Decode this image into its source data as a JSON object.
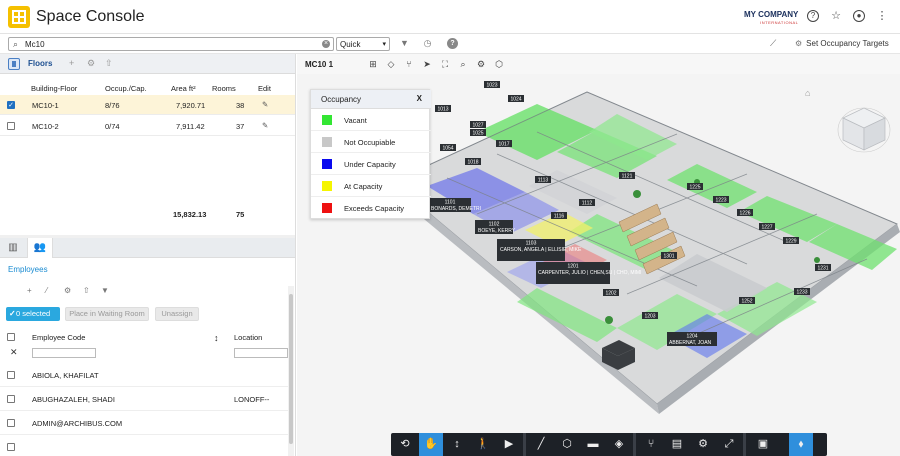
{
  "app": {
    "title": "Space Console",
    "company": "MY COMPANY",
    "company_sub": "INTERNATIONAL"
  },
  "topbar": {
    "icons": [
      "help-icon",
      "star-settings-icon",
      "user-icon",
      "more-icon"
    ]
  },
  "search": {
    "value": "Mc10",
    "mode": "Quick",
    "occupancy_targets_label": "Set Occupancy Targets"
  },
  "floors": {
    "title": "Floors",
    "columns": [
      "Building-Floor",
      "Occup./Cap.",
      "Area ft²",
      "Rooms",
      "Edit"
    ],
    "rows": [
      {
        "floor": "MC10-1",
        "occ": "8/76",
        "area": "7,920.71",
        "rooms": "38",
        "selected": true
      },
      {
        "floor": "MC10-2",
        "occ": "0/74",
        "area": "7,911.42",
        "rooms": "37",
        "selected": false
      }
    ],
    "total_area": "15,832.13",
    "total_rooms": "75"
  },
  "employees": {
    "title": "Employees",
    "selected_btn": "0 selected",
    "waiting_btn": "Place in Waiting Room",
    "unassign_btn": "Unassign",
    "col_code": "Employee Code",
    "col_location": "Location",
    "rows": [
      {
        "code": "ABIOLA, KHAFILAT",
        "location": ""
      },
      {
        "code": "ABUGHAZALEH, SHADI",
        "location": "LONOFF--"
      },
      {
        "code": "ADMIN@ARCHIBUS.COM",
        "location": ""
      }
    ]
  },
  "viewer": {
    "floor_label": "MC10 1",
    "legend_title": "Occupancy",
    "legend_close": "X",
    "legend": [
      {
        "label": "Vacant",
        "color": "#33e633"
      },
      {
        "label": "Not Occupiable",
        "color": "#c8c8c8"
      },
      {
        "label": "Under Capacity",
        "color": "#0a0aef"
      },
      {
        "label": "At Capacity",
        "color": "#f5f500"
      },
      {
        "label": "Exceeds Capacity",
        "color": "#ee1111"
      }
    ],
    "room_tags": [
      {
        "text": "1013"
      },
      {
        "text": "1023"
      },
      {
        "text": "1024"
      },
      {
        "text": "1027"
      },
      {
        "text": "1025"
      },
      {
        "text": "1054"
      },
      {
        "text": "1017"
      },
      {
        "text": "1018"
      },
      {
        "text": "1113"
      },
      {
        "text": "1121"
      },
      {
        "text": "1112"
      },
      {
        "text": "1116"
      },
      {
        "text": "1225"
      },
      {
        "text": "1223"
      },
      {
        "text": "1226"
      },
      {
        "text": "1227"
      },
      {
        "text": "1229"
      },
      {
        "text": "1301"
      },
      {
        "text": "1231"
      },
      {
        "text": "1233"
      },
      {
        "text": "1252"
      },
      {
        "text": "1202"
      },
      {
        "text": "1203"
      }
    ],
    "occupant_tags": [
      {
        "room": "1101",
        "name": "BONARDS, DEMETRI"
      },
      {
        "room": "1102",
        "name": "BOEYE, KERRY"
      },
      {
        "room": "1103",
        "name": "CARSON, ANGELA | ELLISIE, MIKE"
      },
      {
        "room": "1201",
        "name": "CARPENTER, JULIO | CHEN,SU | CHO, MIMI"
      },
      {
        "room": "1204",
        "name": "ABBERNAT, JOAN"
      }
    ]
  }
}
